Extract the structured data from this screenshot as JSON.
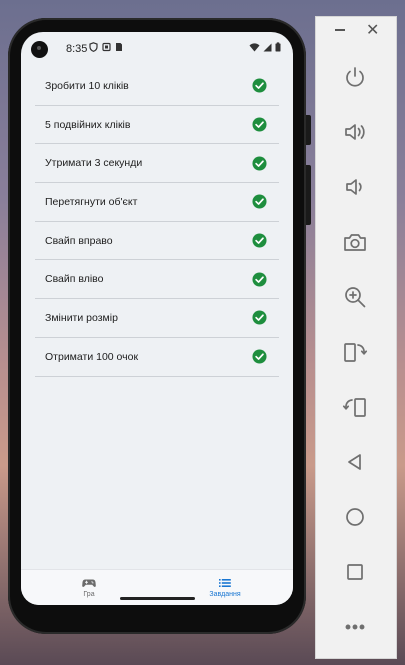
{
  "status_bar": {
    "time": "8:35"
  },
  "tasks": [
    {
      "label": "Зробити 10 кліків",
      "done": true
    },
    {
      "label": "5 подвійних кліків",
      "done": true
    },
    {
      "label": "Утримати 3 секунди",
      "done": true
    },
    {
      "label": "Перетягнути об'єкт",
      "done": true
    },
    {
      "label": "Свайп вправо",
      "done": true
    },
    {
      "label": "Свайп вліво",
      "done": true
    },
    {
      "label": "Змінити розмір",
      "done": true
    },
    {
      "label": "Отримати 100 очок",
      "done": true
    }
  ],
  "bottom_nav": {
    "game_label": "Гра",
    "tasks_label": "Завдання",
    "active": "tasks"
  },
  "colors": {
    "check": "#1e8e3e",
    "accent": "#1976d2"
  },
  "icons": {
    "toolbar": [
      "power-icon",
      "volume-up-icon",
      "volume-down-icon",
      "camera-icon",
      "zoom-icon",
      "rotate-left-icon",
      "rotate-right-icon",
      "back-icon",
      "home-icon",
      "overview-icon",
      "more-icon"
    ]
  }
}
